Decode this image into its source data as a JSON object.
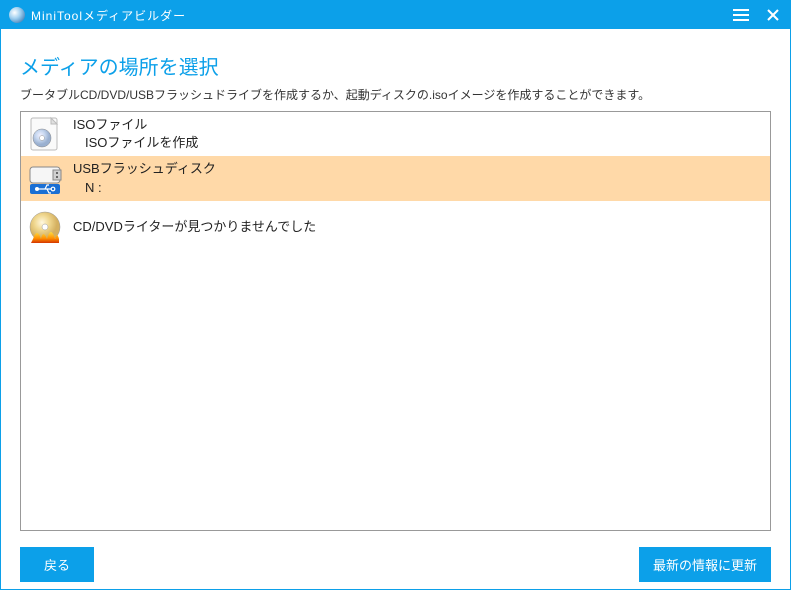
{
  "titlebar": {
    "title": "MiniToolメディアビルダー"
  },
  "header": {
    "title": "メディアの場所を選択",
    "subtitle": "ブータブルCD/DVD/USBフラッシュドライブを作成するか、起動ディスクの.isoイメージを作成することができます。"
  },
  "media_options": {
    "iso": {
      "title": "ISOファイル",
      "subtitle": "ISOファイルを作成"
    },
    "usb": {
      "title": "USBフラッシュディスク",
      "subtitle": "N :"
    },
    "cddvd": {
      "title": "CD/DVDライターが見つかりませんでした"
    }
  },
  "footer": {
    "back_label": "戻る",
    "refresh_label": "最新の情報に更新"
  }
}
